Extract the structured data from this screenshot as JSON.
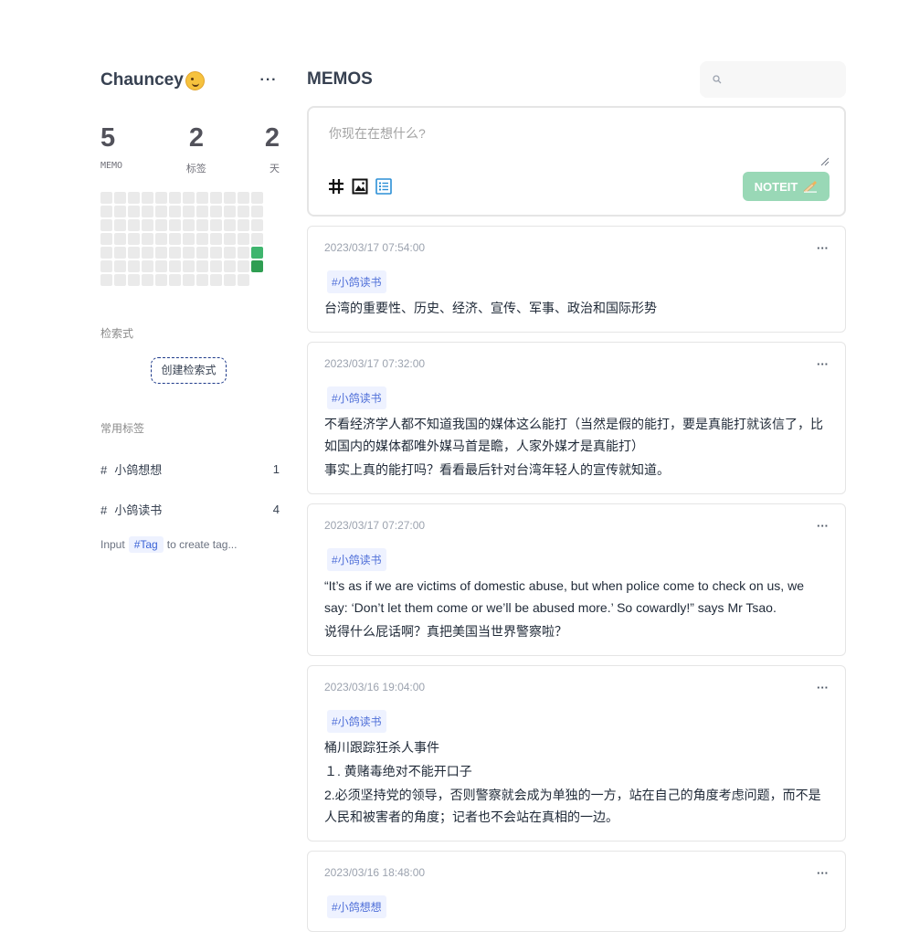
{
  "sidebar": {
    "username": "Chauncey",
    "more": "···",
    "stats": [
      {
        "value": "5",
        "label": "MEMO"
      },
      {
        "value": "2",
        "label": "标签"
      },
      {
        "value": "2",
        "label": "天"
      }
    ],
    "heatmap": {
      "empty_color": "#eaeaea",
      "active_colors": [
        "#3fb56e",
        "#2f9e52"
      ],
      "active_days": 2
    },
    "shortcuts_title": "检索式",
    "create_shortcut": "创建检索式",
    "tags_title": "常用标签",
    "tags": [
      {
        "hash": "#",
        "name": "小鸽想想",
        "count": "1"
      },
      {
        "hash": "#",
        "name": "小鸽读书",
        "count": "4"
      }
    ],
    "hint": {
      "prefix": "Input",
      "chip": "#Tag",
      "suffix": "to create tag..."
    }
  },
  "main": {
    "title": "MEMOS",
    "search": {
      "icon": "search-icon",
      "placeholder": ""
    },
    "editor": {
      "placeholder": "你现在在想什么?",
      "submit_label": "NOTEIT",
      "submit_color": "#99d8b6",
      "tools": [
        "hash-icon",
        "image-icon",
        "list-icon"
      ]
    },
    "memos": [
      {
        "time": "2023/03/17 07:54:00",
        "tag": "#小鸽读书",
        "lines": [
          "台湾的重要性、历史、经济、宣传、军事、政治和国际形势"
        ]
      },
      {
        "time": "2023/03/17 07:32:00",
        "tag": "#小鸽读书",
        "lines": [
          "不看经济学人都不知道我国的媒体这么能打（当然是假的能打，要是真能打就该信了，比如国内的媒体都唯外媒马首是瞻，人家外媒才是真能打）",
          "事实上真的能打吗？看看最后针对台湾年轻人的宣传就知道。"
        ]
      },
      {
        "time": "2023/03/17 07:27:00",
        "tag": "#小鸽读书",
        "lines": [
          "“It’s as if we are victims of domestic abuse, but when police come to check on us, we say: ‘Don’t let them come or we’ll be abused more.’ So cowardly!” says Mr Tsao.",
          "说得什么屁话啊？真把美国当世界警察啦？"
        ]
      },
      {
        "time": "2023/03/16 19:04:00",
        "tag": "#小鸽读书",
        "lines": [
          "桶川跟踪狂杀人事件",
          "１. 黄赌毒绝对不能开口子",
          "2.必须坚持党的领导，否则警察就会成为单独的一方，站在自己的角度考虑问题，而不是人民和被害者的角度；记者也不会站在真相的一边。"
        ]
      },
      {
        "time": "2023/03/16 18:48:00",
        "tag": "#小鸽想想",
        "lines": []
      }
    ]
  }
}
